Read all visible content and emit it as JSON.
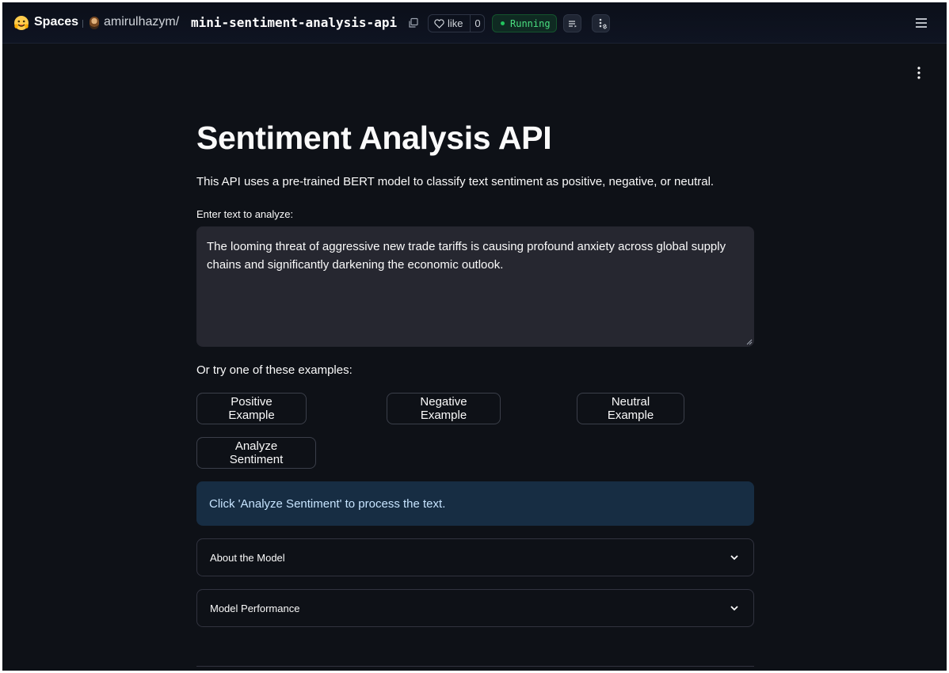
{
  "topbar": {
    "brand": "Spaces",
    "owner": "amirulhazym",
    "separator": "/",
    "repo": "mini-sentiment-analysis-api",
    "like_label": "like",
    "like_count": "0",
    "status": "Running"
  },
  "main": {
    "title": "Sentiment Analysis API",
    "subtitle": "This API uses a pre-trained BERT model to classify text sentiment as positive, negative, or neutral.",
    "input_label": "Enter text to analyze:",
    "input_value": "The looming threat of aggressive new trade tariffs is causing profound anxiety across global supply chains and significantly darkening the economic outlook.",
    "examples_label": "Or try one of these examples:",
    "buttons": {
      "positive": "Positive Example",
      "negative": "Negative Example",
      "neutral": "Neutral Example",
      "analyze": "Analyze Sentiment"
    },
    "info": "Click 'Analyze Sentiment' to process the text.",
    "expanders": [
      {
        "label": "About the Model"
      },
      {
        "label": "Model Performance"
      }
    ]
  },
  "colors": {
    "background": "#0e1117",
    "input_bg": "#262730",
    "info_bg": "#172d43",
    "status_green": "#22c55e"
  }
}
